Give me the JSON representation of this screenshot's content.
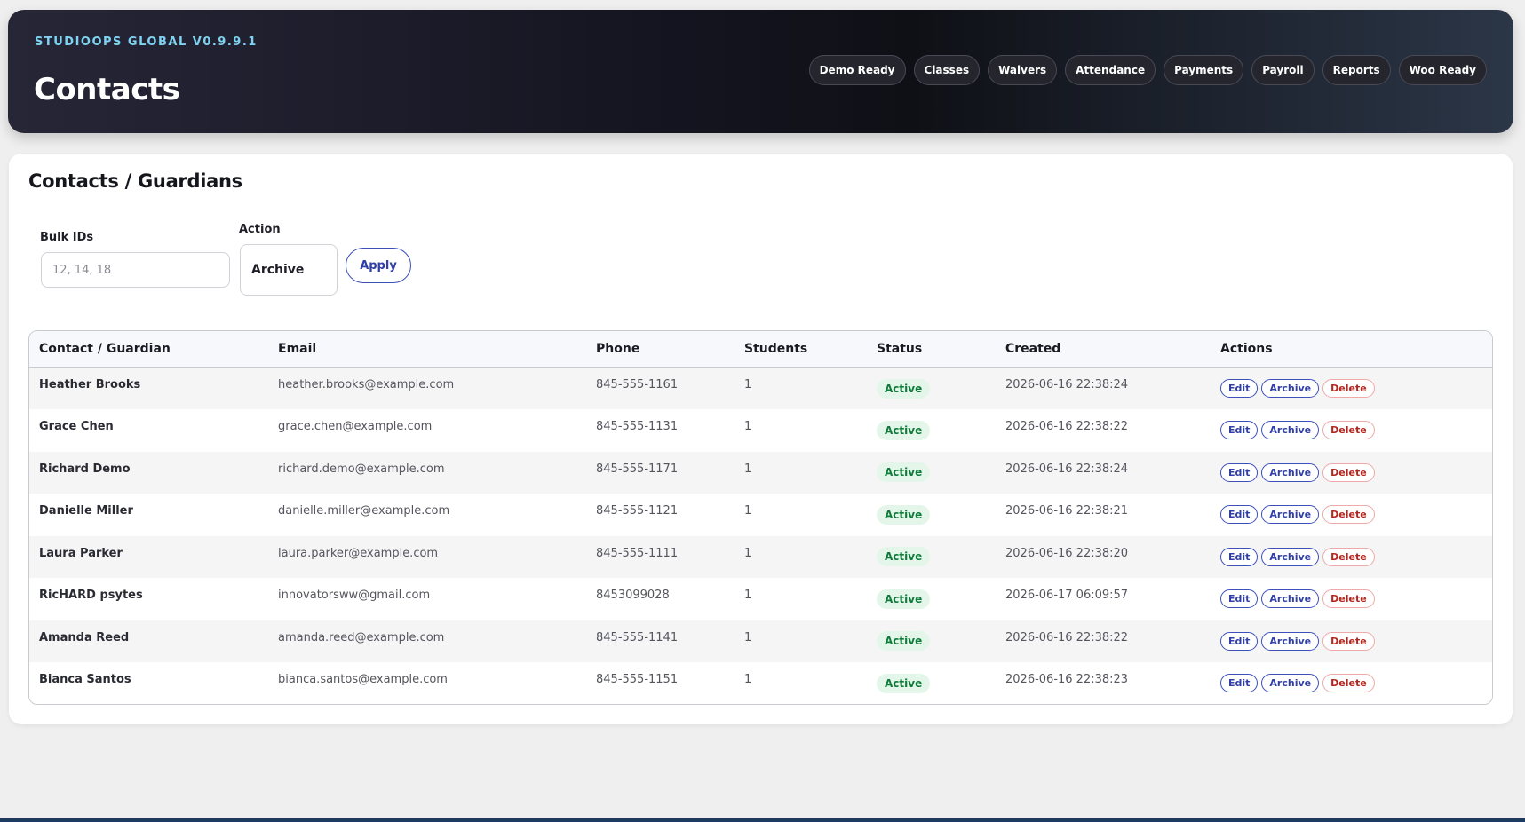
{
  "header": {
    "kicker": "STUDIOOPS GLOBAL V0.9.9.1",
    "title": "Contacts",
    "nav": [
      "Demo Ready",
      "Classes",
      "Waivers",
      "Attendance",
      "Payments",
      "Payroll",
      "Reports",
      "Woo Ready"
    ]
  },
  "card": {
    "title": "Contacts / Guardians",
    "bulk_label": "Bulk IDs",
    "bulk_placeholder": "12, 14, 18",
    "action_label": "Action",
    "action_value": "Archive",
    "apply_label": "Apply"
  },
  "table": {
    "columns": [
      "Contact / Guardian",
      "Email",
      "Phone",
      "Students",
      "Status",
      "Created",
      "Actions"
    ],
    "actions": {
      "edit": "Edit",
      "archive": "Archive",
      "delete": "Delete"
    },
    "rows": [
      {
        "name": "Heather Brooks",
        "email": "heather.brooks@example.com",
        "phone": "845-555-1161",
        "students": "1",
        "status": "Active",
        "created": "2026-06-16 22:38:24"
      },
      {
        "name": "Grace Chen",
        "email": "grace.chen@example.com",
        "phone": "845-555-1131",
        "students": "1",
        "status": "Active",
        "created": "2026-06-16 22:38:22"
      },
      {
        "name": "Richard Demo",
        "email": "richard.demo@example.com",
        "phone": "845-555-1171",
        "students": "1",
        "status": "Active",
        "created": "2026-06-16 22:38:24"
      },
      {
        "name": "Danielle Miller",
        "email": "danielle.miller@example.com",
        "phone": "845-555-1121",
        "students": "1",
        "status": "Active",
        "created": "2026-06-16 22:38:21"
      },
      {
        "name": "Laura Parker",
        "email": "laura.parker@example.com",
        "phone": "845-555-1111",
        "students": "1",
        "status": "Active",
        "created": "2026-06-16 22:38:20"
      },
      {
        "name": "RicHARD psytes",
        "email": "innovatorsww@gmail.com",
        "phone": "8453099028",
        "students": "1",
        "status": "Active",
        "created": "2026-06-17 06:09:57"
      },
      {
        "name": "Amanda Reed",
        "email": "amanda.reed@example.com",
        "phone": "845-555-1141",
        "students": "1",
        "status": "Active",
        "created": "2026-06-16 22:38:22"
      },
      {
        "name": "Bianca Santos",
        "email": "bianca.santos@example.com",
        "phone": "845-555-1151",
        "students": "1",
        "status": "Active",
        "created": "2026-06-16 22:38:23"
      }
    ]
  },
  "colors": {
    "accent": "#3140a8",
    "kicker": "#7fd3f2",
    "status_active_bg": "#e4f6ea",
    "status_active_text": "#0f7a3a",
    "delete": "#b3261e"
  }
}
